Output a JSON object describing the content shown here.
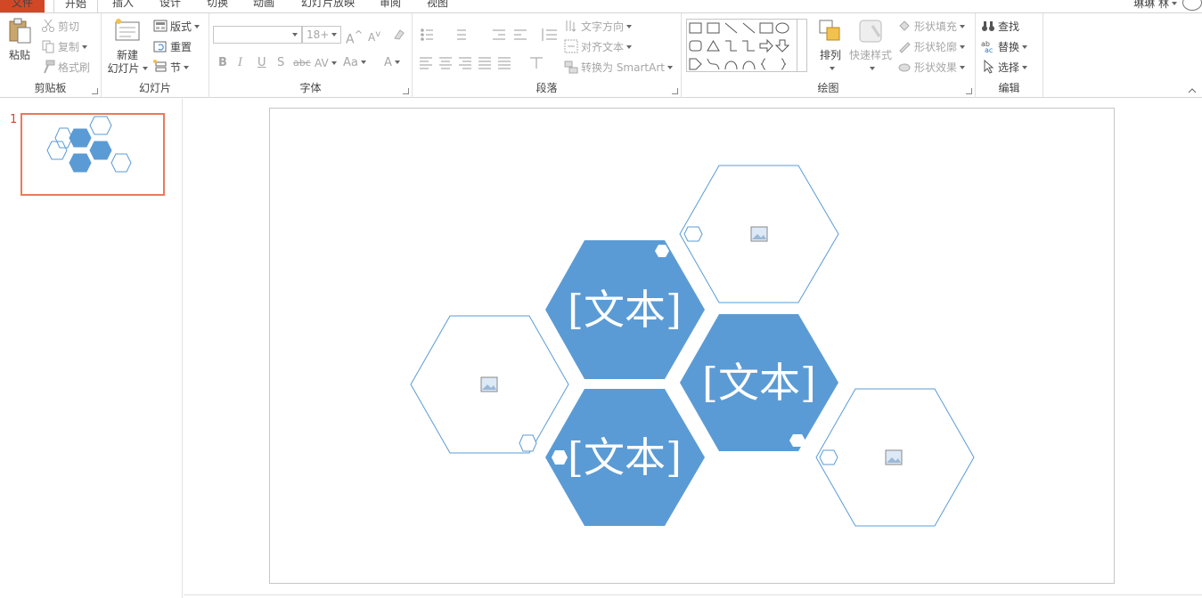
{
  "tabs": {
    "file": "文件",
    "home": "开始",
    "insert": "插入",
    "design": "设计",
    "transitions": "切换",
    "animations": "动画",
    "slideshow": "幻灯片放映",
    "review": "审阅",
    "view": "视图"
  },
  "user": {
    "name": "琳琳 林"
  },
  "ribbon": {
    "clipboard": {
      "label": "剪贴板",
      "paste": "粘贴",
      "cut": "剪切",
      "copy": "复制",
      "format_painter": "格式刷"
    },
    "slides": {
      "label": "幻灯片",
      "new_slide_line1": "新建",
      "new_slide_line2": "幻灯片",
      "layout": "版式",
      "reset": "重置",
      "section": "节"
    },
    "font": {
      "label": "字体",
      "font_name": "",
      "font_size": "18+",
      "bold": "B",
      "italic": "I",
      "underline": "U",
      "shadow": "S",
      "strike": "abc",
      "spacing": "AV",
      "case": "Aa",
      "color": "A",
      "grow": "A",
      "shrink": "A"
    },
    "paragraph": {
      "label": "段落",
      "text_direction": "文字方向",
      "align_text": "对齐文本",
      "convert_smartart": "转换为 SmartArt"
    },
    "drawing": {
      "label": "绘图",
      "arrange": "排列",
      "quick_styles": "快速样式",
      "shape_fill": "形状填充",
      "shape_outline": "形状轮廓",
      "shape_effects": "形状效果"
    },
    "editing": {
      "label": "编辑",
      "find": "查找",
      "replace": "替换",
      "select": "选择"
    }
  },
  "thumbnails": [
    {
      "number": "1"
    }
  ],
  "slide": {
    "placeholders": [
      "[文本]",
      "[文本]",
      "[文本]"
    ]
  },
  "colors": {
    "accent": "#d24726",
    "hex_fill": "#5b9bd5",
    "hex_outline": "#5b9bd5"
  }
}
